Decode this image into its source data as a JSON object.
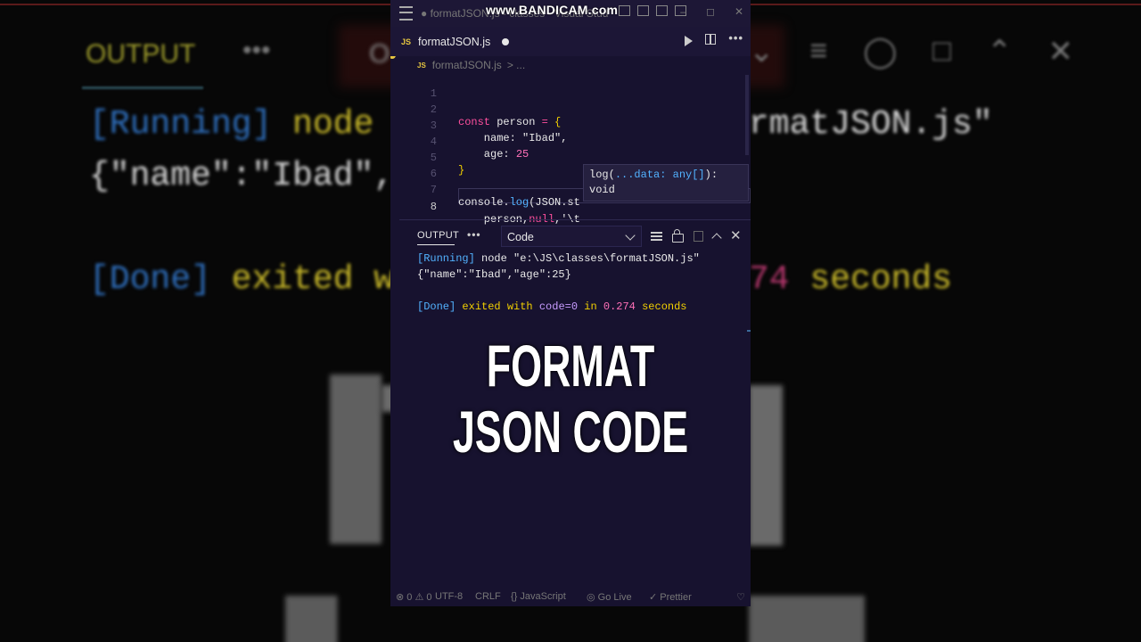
{
  "background": {
    "output_label": "OUTPUT",
    "dots": "•••",
    "letter_o": "O",
    "line1_running": "[Running]",
    "line1_node": " node",
    "line1_right": "rmatJSON.js\"",
    "line2": "{\"name\":\"Ibad\",",
    "line3_done": "[Done]",
    "line3_exited": " exited w",
    "line3_right_num": "74",
    "line3_right_text": " seconds"
  },
  "window": {
    "title": "● formatJSON.js - classes - Visual Stud",
    "watermark": "www.BANDICAM.com"
  },
  "tab": {
    "icon": "JS",
    "label": "formatJSON.js",
    "modified": true
  },
  "breadcrumb": {
    "icon": "JS",
    "file": "formatJSON.js",
    "sep": "> ..."
  },
  "editor": {
    "lines": [
      {
        "n": "1"
      },
      {
        "n": "2",
        "kw": "const",
        "id": " person ",
        "eq": "= ",
        "brace": "{"
      },
      {
        "n": "3",
        "id": "    name: ",
        "str": "\"Ibad\","
      },
      {
        "n": "4",
        "id": "    age: ",
        "num": "25"
      },
      {
        "n": "5",
        "brace": "}"
      },
      {
        "n": "6"
      },
      {
        "n": "7",
        "id": "console.",
        "fn": "log",
        "rest": "(JSON.st"
      },
      {
        "n": "8",
        "id": "    person,",
        "nul": "null",
        "rest": ",'\\t"
      }
    ],
    "tooltip_line1_a": "log(",
    "tooltip_line1_b": "...data: any[]",
    "tooltip_line1_c": "):",
    "tooltip_line2": "void"
  },
  "panel": {
    "tab_label": "OUTPUT",
    "more": "•••",
    "channel": "Code",
    "output": {
      "running": "[Running]",
      "running_rest": " node \"e:\\JS\\classes\\formatJSON.js\"",
      "result": "{\"name\":\"Ibad\",\"age\":25}",
      "done": "[Done]",
      "exited": " exited with ",
      "code": "code=0",
      "in": " in ",
      "time": "0.274",
      "seconds": " seconds"
    }
  },
  "caption": {
    "line1": "FORMAT",
    "line2": "JSON CODE"
  },
  "statusbar": {
    "errors": "⊗ 0 ⚠ 0",
    "encoding": "UTF-8",
    "eol": "CRLF",
    "language": "{} JavaScript",
    "golive": "◎ Go Live",
    "prettier": "✓ Prettier",
    "bell": "🔔"
  },
  "colors": {
    "editor_bg": "#17122f",
    "keyword": "#ff4f9e",
    "function": "#52b2ff",
    "brace": "#f2d000"
  }
}
